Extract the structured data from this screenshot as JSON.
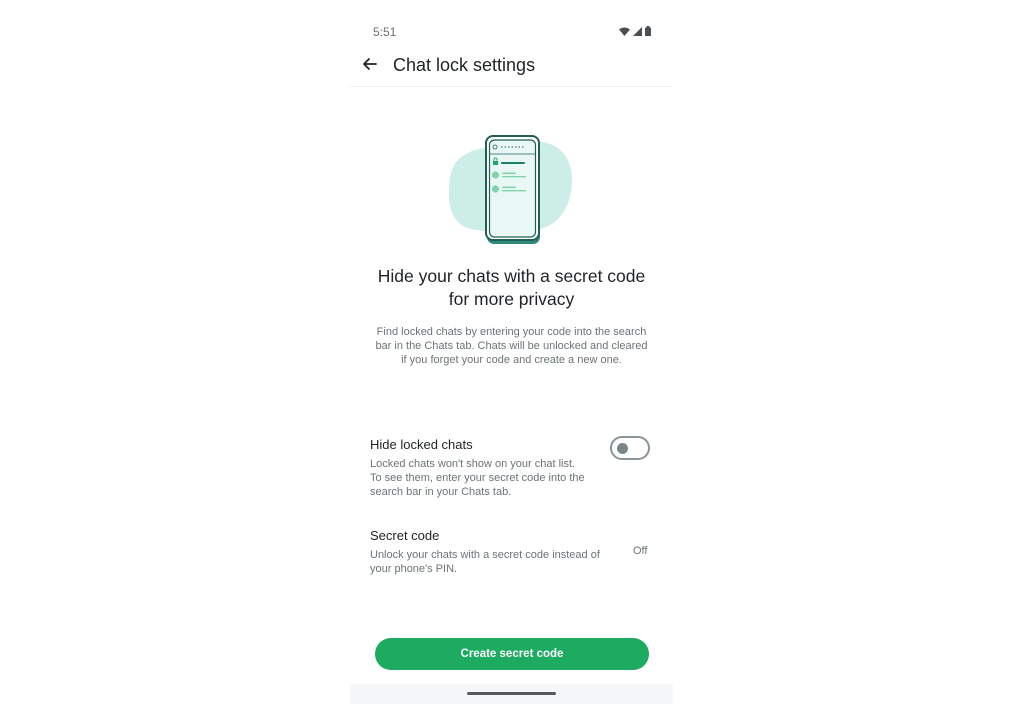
{
  "status_bar": {
    "time": "5:51",
    "icons": [
      "wifi-icon",
      "cellular-signal-icon",
      "battery-icon"
    ]
  },
  "app_bar": {
    "back_icon": "arrow-left-icon",
    "title": "Chat lock settings"
  },
  "illustration": {
    "semantic": "phone-with-locked-chat-list",
    "colors": {
      "blob": "#cdeee6",
      "frame": "#1f6f62",
      "accent": "#1daa61"
    }
  },
  "intro": {
    "headline_line1": "Hide your chats with a secret code",
    "headline_line2": "for more privacy",
    "description": "Find locked chats by entering your code into the search bar in the Chats tab. Chats will be unlocked and cleared if you forget your code and create a new one."
  },
  "settings": [
    {
      "title": "Hide locked chats",
      "description": "Locked chats won't show on your chat list. To see them, enter your secret code into the search bar in your Chats tab.",
      "control": "toggle",
      "enabled": false
    },
    {
      "title": "Secret code",
      "description": "Unlock your chats with a secret code instead of your phone's PIN.",
      "value": "Off"
    }
  ],
  "primary_button": {
    "label": "Create secret code",
    "color": "#1daa61"
  }
}
